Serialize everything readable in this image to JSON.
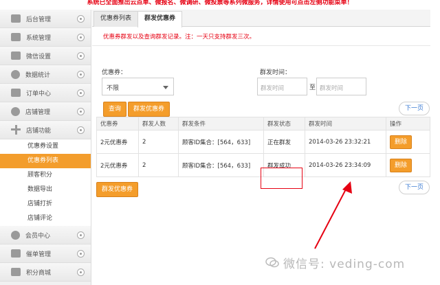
{
  "banner": "系统已全面推出云点单、微报名、微调研、微投票等系列微服务，详情使用可点击左侧功能菜单！",
  "sidebar": {
    "items": [
      {
        "label": "后台管理",
        "icon": "home-icon"
      },
      {
        "label": "系统管理",
        "icon": "gear-icon"
      },
      {
        "label": "微信设置",
        "icon": "mail-icon"
      },
      {
        "label": "数据统计",
        "icon": "chart-icon"
      },
      {
        "label": "订单中心",
        "icon": "printer-icon"
      },
      {
        "label": "店铺管理",
        "icon": "shop-icon"
      },
      {
        "label": "店铺功能",
        "icon": "plus-icon"
      }
    ],
    "sub_items": [
      {
        "label": "优惠券设置",
        "active": false
      },
      {
        "label": "优惠券列表",
        "active": true
      },
      {
        "label": "顾客积分",
        "active": false
      },
      {
        "label": "数据导出",
        "active": false
      },
      {
        "label": "店铺打折",
        "active": false
      },
      {
        "label": "店铺评论",
        "active": false
      }
    ],
    "items_after": [
      {
        "label": "会员中心",
        "icon": "member-icon"
      },
      {
        "label": "催单管理",
        "icon": "printer-icon"
      },
      {
        "label": "积分商城",
        "icon": "mall-icon"
      }
    ]
  },
  "tabs": [
    {
      "label": "优惠券列表"
    },
    {
      "label": "群发优惠券"
    }
  ],
  "notice": "优惠券群发以及查询群发记录。注：一天只支持群发三次。",
  "filters": {
    "coupon_label": "优惠券：",
    "coupon_value": "不限",
    "time_label": "群发时间：",
    "time_from_placeholder": "群发时间",
    "time_to_placeholder": "群发时间",
    "to_label": "至"
  },
  "buttons": {
    "query": "查询",
    "send_coupon": "群发优惠券",
    "next_page": "下一页"
  },
  "table": {
    "headers": [
      "优惠券",
      "群发人数",
      "群发条件",
      "群发状态",
      "群发时间",
      "操作"
    ],
    "rows": [
      {
        "coupon": "2元优惠券",
        "count": "2",
        "condition": "顾客ID集合：[564，633]",
        "status": "正在群发",
        "time": "2014-03-26 23:32:21",
        "action": "删除"
      },
      {
        "coupon": "2元优惠券",
        "count": "2",
        "condition": "顾客ID集合：[564，633]",
        "status": "群发成功",
        "time": "2014-03-26 23:34:09",
        "action": "删除"
      }
    ]
  },
  "watermark": "微信号: veding-com",
  "colors": {
    "accent": "#f49d2b",
    "notice": "#e60012",
    "link": "#3c7bd2"
  }
}
